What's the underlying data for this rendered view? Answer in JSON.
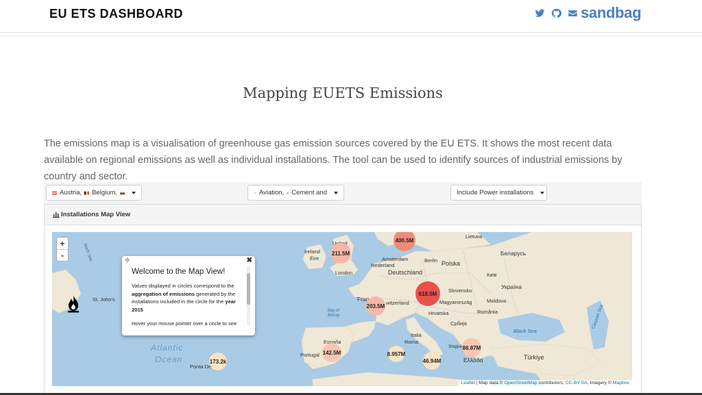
{
  "header": {
    "brand": "EU ETS DASHBOARD",
    "social_icons": [
      "twitter-icon",
      "github-icon",
      "mail-icon"
    ],
    "logo_text": "sandbag",
    "logo_color": "#4a7fc3"
  },
  "page": {
    "title": "Mapping EUETS Emissions",
    "intro": "The emissions map is a visualisation of greenhouse gas emission sources covered by the EU ETS. It shows the most recent data available on regional emissions as well as individual installations. The tool can be used to identify sources of industrial emissions by country and sector."
  },
  "filters": {
    "countries_label": "Austria,   Belgium,  ",
    "countries_first": "Austria,",
    "countries_second": "Belgium,",
    "sectors_first": "Aviation,",
    "sectors_second": "Cement and",
    "power_label": "Include Power installations"
  },
  "panel": {
    "title": "Installations Map View"
  },
  "map": {
    "zoom_in": "+",
    "zoom_out": "-",
    "clusters": [
      {
        "label": "400.5M",
        "color": "#f08a7a"
      },
      {
        "label": "211.5M",
        "color": "#f5b8a4"
      },
      {
        "label": "618.5M",
        "color": "#e8524b"
      },
      {
        "label": "203.5M",
        "color": "#f5b8a4"
      },
      {
        "label": "142.5M",
        "color": "#f6c7b3"
      },
      {
        "label": "8.957M",
        "color": "#f7e4c3"
      },
      {
        "label": "46.94M",
        "color": "#f7e4c3"
      },
      {
        "label": "86.87M",
        "color": "#f6c7b3"
      },
      {
        "label": "173.2k",
        "color": "#f7e4c3"
      }
    ],
    "labels": {
      "united": "United",
      "ireland": "Ireland",
      "eire": "Éire",
      "london": "London",
      "nederland": "Nederland",
      "amsterdam": "Amsterdam",
      "deutschland": "Deutschland",
      "berlin": "Berlin",
      "polska": "Polska",
      "lietuva": "Lietuva",
      "belarus": "Беларусь",
      "kyiv": "Київ",
      "ukraina": "Україна",
      "moldova": "Moldova",
      "slovensko": "Slovensko",
      "magyarorszag": "Magyarország",
      "hrvatska": "Hrvatska",
      "srbija": "Србија",
      "romania": "România",
      "switzerland": "witzerland",
      "france": "France",
      "italia": "Italia",
      "roma": "Roma",
      "espana": "España",
      "portugal": "Portugal",
      "ellada": "Ελλάδα",
      "shqiperia": "Shqipëria",
      "turkiye": "Türkiye",
      "black_sea": "Black Sea",
      "caspian_sea": "Caspian Sea",
      "bay_of_biscay": "Bay of Biscay",
      "north_sea": "North Sea",
      "st_johns": "St. John's",
      "ponta_delgada": "Ponta De",
      "atlantic": "Atlantic",
      "ocean": "Ocean"
    },
    "popup": {
      "title": "Welcome to the Map View!",
      "body_1": "Values displayed in circles correspond to the ",
      "body_bold_1": "aggregation of emissions",
      "body_2": " generated by the installations included in the circle for the ",
      "body_bold_2": "year 2015",
      "body_3": "Hover your mouse pointer over a circle to see",
      "close": "✖"
    },
    "attribution": {
      "leaflet": "Leaflet",
      "text_1": " | Map data © ",
      "osm": "OpenStreetMap",
      "text_2": " contributors, ",
      "license": "CC-BY-SA",
      "text_3": ", Imagery © ",
      "mapbox": "Mapbox"
    },
    "colors": {
      "water": "#a9cbe6",
      "land": "#efe8d6"
    }
  }
}
